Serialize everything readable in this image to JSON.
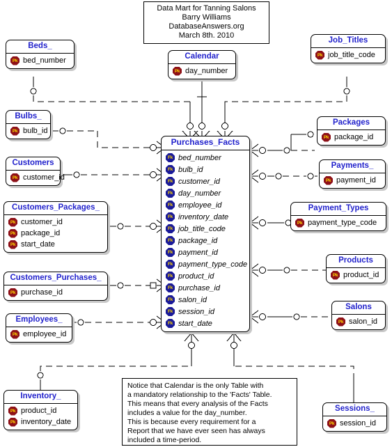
{
  "diagram": {
    "title_lines": [
      "Data Mart for Tanning Salons",
      "Barry Williams",
      "DatabaseAnswers.org",
      "March 8th. 2010"
    ],
    "note_lines": [
      "Notice that Calendar is the only Table with",
      "a mandatory relationship to the 'Facts' Table.",
      "This means that every analysis of the Facts",
      " includes a value for the day_number.",
      "This is because every requirement for a",
      "Report that we have ever seen has always",
      "included a time-period."
    ],
    "colors": {
      "entity_title": "#2222CC",
      "pk_badge": "#8E1018",
      "fk_badge": "#1A1A99",
      "badge_text": "#FFD700",
      "line": "#000000",
      "background": "#FFFFFF",
      "shadow": "#C8C8C8"
    },
    "key_labels": {
      "pk": "Pk",
      "fk": "Fk"
    }
  },
  "entities": {
    "beds": {
      "name": "Beds_",
      "attributes": [
        {
          "key": "Pk",
          "name": "bed_number"
        }
      ]
    },
    "bulbs": {
      "name": "Bulbs_",
      "attributes": [
        {
          "key": "Pk",
          "name": "bulb_id"
        }
      ]
    },
    "customers": {
      "name": "Customers",
      "attributes": [
        {
          "key": "Pk",
          "name": "customer_id"
        }
      ]
    },
    "customers_packages": {
      "name": "Customers_Packages_",
      "attributes": [
        {
          "key": "Pk",
          "name": "customer_id"
        },
        {
          "key": "Pk",
          "name": "package_id"
        },
        {
          "key": "Pk",
          "name": "start_date"
        }
      ]
    },
    "customers_purchases": {
      "name": "Customers_Purchases_",
      "attributes": [
        {
          "key": "Pk",
          "name": "purchase_id"
        }
      ]
    },
    "employees": {
      "name": "Employees_",
      "attributes": [
        {
          "key": "Pk",
          "name": "employee_id"
        }
      ]
    },
    "inventory": {
      "name": "Inventory_",
      "attributes": [
        {
          "key": "Pk",
          "name": "product_id"
        },
        {
          "key": "Pk",
          "name": "inventory_date"
        }
      ]
    },
    "calendar": {
      "name": "Calendar",
      "attributes": [
        {
          "key": "Pk",
          "name": "day_number"
        }
      ]
    },
    "job_titles": {
      "name": "Job_Titles",
      "attributes": [
        {
          "key": "Pk",
          "name": "job_title_code"
        }
      ]
    },
    "packages": {
      "name": "Packages",
      "attributes": [
        {
          "key": "Pk",
          "name": "package_id"
        }
      ]
    },
    "payments": {
      "name": "Payments_",
      "attributes": [
        {
          "key": "Pk",
          "name": "payment_id"
        }
      ]
    },
    "payment_types": {
      "name": "Payment_Types",
      "attributes": [
        {
          "key": "Pk",
          "name": "payment_type_code"
        }
      ]
    },
    "products": {
      "name": "Products",
      "attributes": [
        {
          "key": "Pk",
          "name": "product_id"
        }
      ]
    },
    "salons": {
      "name": "Salons",
      "attributes": [
        {
          "key": "Pk",
          "name": "salon_id"
        }
      ]
    },
    "sessions": {
      "name": "Sessions_",
      "attributes": [
        {
          "key": "Pk",
          "name": "session_id"
        }
      ]
    },
    "purchases_facts": {
      "name": "Purchases_Facts",
      "attributes": [
        {
          "key": "Fk",
          "name": "bed_number"
        },
        {
          "key": "Fk",
          "name": "bulb_id"
        },
        {
          "key": "Fk",
          "name": "customer_id"
        },
        {
          "key": "Fk",
          "name": "day_number"
        },
        {
          "key": "Fk",
          "name": "employee_id"
        },
        {
          "key": "Fk",
          "name": "inventory_date"
        },
        {
          "key": "Fk",
          "name": "job_title_code"
        },
        {
          "key": "Fk",
          "name": "package_id"
        },
        {
          "key": "Fk",
          "name": "payment_id"
        },
        {
          "key": "Fk",
          "name": "payment_type_code"
        },
        {
          "key": "Fk",
          "name": "product_id"
        },
        {
          "key": "Fk",
          "name": "purchase_id"
        },
        {
          "key": "Fk",
          "name": "salon_id"
        },
        {
          "key": "Fk",
          "name": "session_id"
        },
        {
          "key": "Fk",
          "name": "start_date"
        }
      ]
    }
  }
}
